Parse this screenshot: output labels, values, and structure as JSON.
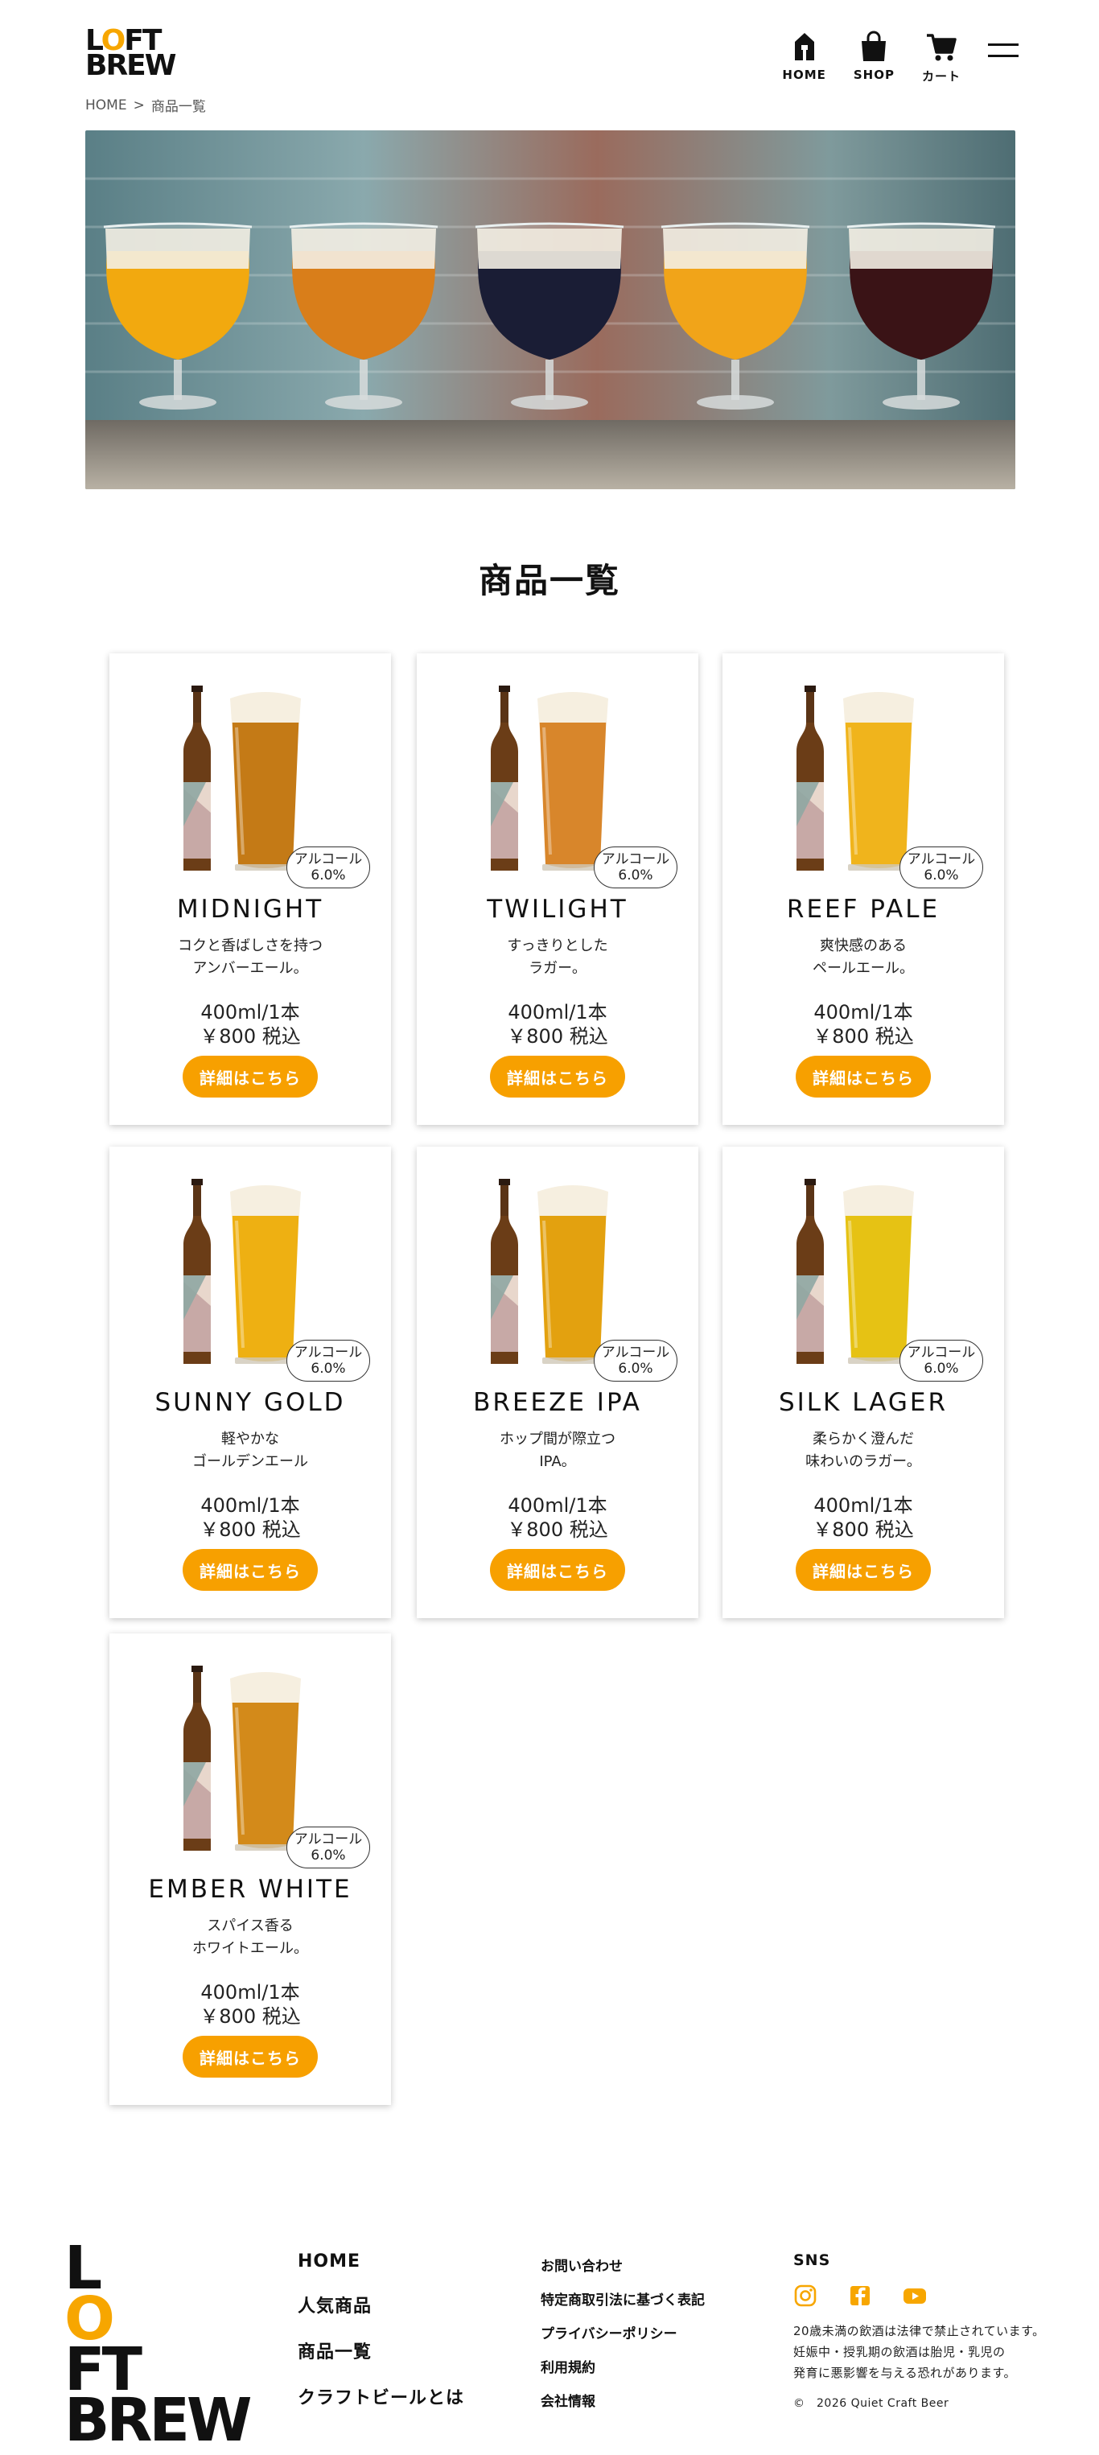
{
  "brand": {
    "logo_line1_a": "L",
    "logo_line1_o": "O",
    "logo_line1_b": "FT",
    "logo_line2": "BREW"
  },
  "nav": {
    "home": "HOME",
    "shop": "SHOP",
    "cart": "カート"
  },
  "breadcrumb": {
    "home": "HOME",
    "separator": ">",
    "current": "商品一覧"
  },
  "page_title": "商品一覧",
  "colors": {
    "accent": "#f7a000",
    "text": "#111111"
  },
  "products": [
    {
      "name": "MIDNIGHT",
      "desc": "コクと香ばしさを持つ\nアンバーエール。",
      "badge_label": "アルコール",
      "abv": "6.0%",
      "size": "400ml/1本",
      "price": "￥800 税込",
      "button": "詳細はこちら",
      "beer_color": "#c47a16"
    },
    {
      "name": "TWILIGHT",
      "desc": "すっきりとした\nラガー。",
      "badge_label": "アルコール",
      "abv": "6.0%",
      "size": "400ml/1本",
      "price": "￥800 税込",
      "button": "詳細はこちら",
      "beer_color": "#d8862b"
    },
    {
      "name": "REEF PALE",
      "desc": "爽快感のある\nペールエール。",
      "badge_label": "アルコール",
      "abv": "6.0%",
      "size": "400ml/1本",
      "price": "￥800 税込",
      "button": "詳細はこちら",
      "beer_color": "#f0b41c"
    },
    {
      "name": "SUNNY GOLD",
      "desc": "軽やかな\nゴールデンエール",
      "badge_label": "アルコール",
      "abv": "6.0%",
      "size": "400ml/1本",
      "price": "￥800 税込",
      "button": "詳細はこちら",
      "beer_color": "#eeb012"
    },
    {
      "name": "BREEZE IPA",
      "desc": "ホップ間が際立つ\nIPA。",
      "badge_label": "アルコール",
      "abv": "6.0%",
      "size": "400ml/1本",
      "price": "￥800 税込",
      "button": "詳細はこちら",
      "beer_color": "#e3a10f"
    },
    {
      "name": "SILK LAGER",
      "desc": "柔らかく澄んだ\n味わいのラガー。",
      "badge_label": "アルコール",
      "abv": "6.0%",
      "size": "400ml/1本",
      "price": "￥800 税込",
      "button": "詳細はこちら",
      "beer_color": "#e6c214"
    },
    {
      "name": "EMBER WHITE",
      "desc": "スパイス香る\nホワイトエール。",
      "badge_label": "アルコール",
      "abv": "6.0%",
      "size": "400ml/1本",
      "price": "￥800 税込",
      "button": "詳細はこちら",
      "beer_color": "#d38a1a"
    }
  ],
  "footer": {
    "nav1": [
      "HOME",
      "人気商品",
      "商品一覧",
      "クラフトビールとは"
    ],
    "nav2": [
      "お問い合わせ",
      "特定商取引法に基づく表記",
      "プライバシーポリシー",
      "利用規約",
      "会社情報"
    ],
    "sns_title": "SNS",
    "sns_icons": [
      "instagram-icon",
      "facebook-icon",
      "youtube-icon"
    ],
    "notice": "20歳未満の飲酒は法律で禁止されています。\n妊娠中・授乳期の飲酒は胎児・乳児の\n発育に悪影響を与える恐れがあります。",
    "copyright": "©　2026 Quiet Craft Beer"
  }
}
